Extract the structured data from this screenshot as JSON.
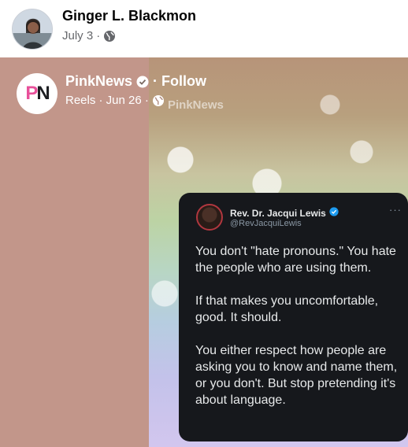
{
  "post": {
    "author": "Ginger L. Blackmon",
    "date": "July 3",
    "separator": "·",
    "audience_icon": "globe-icon"
  },
  "shared": {
    "page_name": "PinkNews",
    "page_logo_text": {
      "p": "P",
      "n": "N"
    },
    "separator": "·",
    "follow_label": "Follow",
    "meta": "Reels · Jun 26 ·",
    "watermark": "PinkNews",
    "verified_icon": "verified-badge-icon"
  },
  "tweet": {
    "name": "Rev. Dr. Jacqui Lewis",
    "handle": "@RevJacquiLewis",
    "more": "···",
    "paragraphs": [
      "You don't \"hate pronouns.\" You hate the people who are using them.",
      "If that makes you uncomfortable, good. It should.",
      "You either respect how people are asking you to know and name them, or you don't. But stop pretending it's about language."
    ]
  },
  "colors": {
    "accent_pink": "#e8509a",
    "verified_blue": "#1d9bf0",
    "tweet_bg": "#16181c"
  }
}
